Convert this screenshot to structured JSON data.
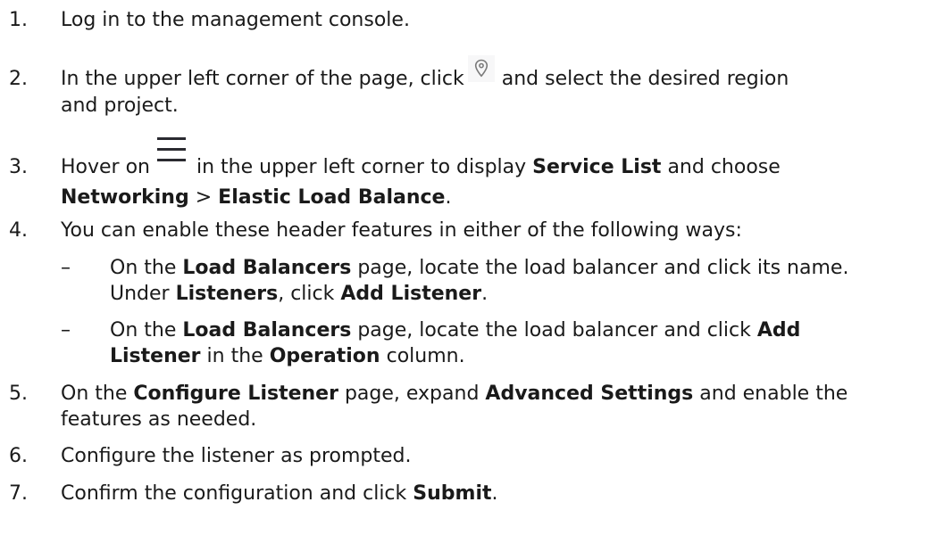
{
  "steps": [
    {
      "num": "1.",
      "parts": [
        "Log in to the management console."
      ]
    },
    {
      "num": "2.",
      "line1_pre": "In the upper left corner of the page, click",
      "icon": "location-pin-icon",
      "line1_post": "and select the desired region",
      "line2": "and project."
    },
    {
      "num": "3.",
      "line1_pre": "Hover on",
      "icon": "hamburger-menu-icon",
      "line1_mid": "in the upper left corner to display",
      "line1_bold": "Service List",
      "line1_post": "and choose",
      "line2_bold1": "Networking",
      "line2_sep": ">",
      "line2_bold2": "Elastic Load Balance",
      "line2_end": "."
    },
    {
      "num": "4.",
      "text": "You can enable these header features in either of the following ways:",
      "subitems": [
        {
          "dash": "–",
          "a": "On the",
          "b": "Load Balancers",
          "c": "page, locate the load balancer and click its name.",
          "d": "Under",
          "e": "Listeners",
          "f": ", click",
          "g": "Add Listener",
          "h": "."
        },
        {
          "dash": "–",
          "a": "On the",
          "b": "Load Balancers",
          "c": "page, locate the load balancer and click",
          "d": "Add",
          "e": "Listener",
          "f": "in the",
          "g": "Operation",
          "h": "column."
        }
      ]
    },
    {
      "num": "5.",
      "a": "On the",
      "b": "Configure Listener",
      "c": "page, expand",
      "d": "Advanced Settings",
      "e": "and enable the",
      "line2": "features as needed."
    },
    {
      "num": "6.",
      "text": "Configure the listener as prompted."
    },
    {
      "num": "7.",
      "a": "Confirm the configuration and click",
      "b": "Submit",
      "c": "."
    }
  ],
  "colors": {
    "text": "#1a1a1a",
    "icon": "#7a7a7a",
    "menu_icon": "#2a2a30"
  }
}
